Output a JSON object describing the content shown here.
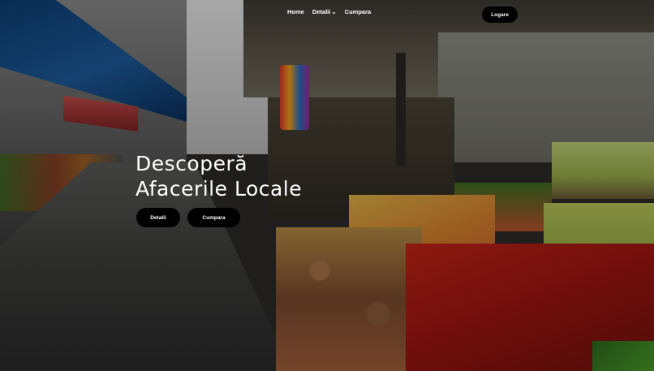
{
  "nav": {
    "items": [
      "Home",
      "Detalii",
      "Cumpara"
    ],
    "login_label": "Logare"
  },
  "hero": {
    "title_line1": "Descoperă",
    "title_line2": "Afacerile Locale",
    "primary_button": "Detalii",
    "secondary_button": "Cumpara"
  },
  "icons": {
    "dropdown": "chevron-down-icon"
  },
  "colors": {
    "button_bg": "#000000",
    "text": "#ffffff"
  }
}
